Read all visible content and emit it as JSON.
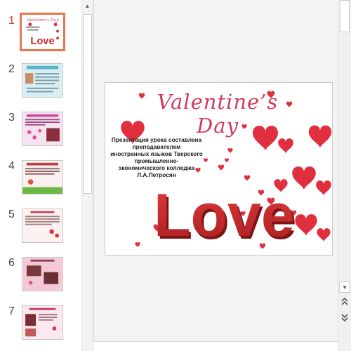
{
  "slides": [
    {
      "number": "1",
      "active": true
    },
    {
      "number": "2",
      "active": false
    },
    {
      "number": "3",
      "active": false
    },
    {
      "number": "4",
      "active": false
    },
    {
      "number": "5",
      "active": false
    },
    {
      "number": "6",
      "active": false
    },
    {
      "number": "7",
      "active": false
    }
  ],
  "slide": {
    "title": "Valentine’s Day",
    "body_lines": [
      "Презентация урока составлена",
      "преподавателем",
      "иностранных языков Тверского",
      "промышленно-",
      "экономического колледжа",
      "Л.А.Петросян"
    ],
    "love_word": "Love"
  },
  "icons": {
    "thumb_scroll_up": "scroll-up-icon",
    "main_scroll_down": "scroll-down-icon",
    "prev_slide": "double-chevron-up-icon",
    "next_slide": "double-chevron-down-icon"
  },
  "colors": {
    "active_accent": "#e8774a",
    "title_pink": "#d33a5c",
    "heart_red": "#e0303f",
    "love_red": "#cf2a2a"
  }
}
